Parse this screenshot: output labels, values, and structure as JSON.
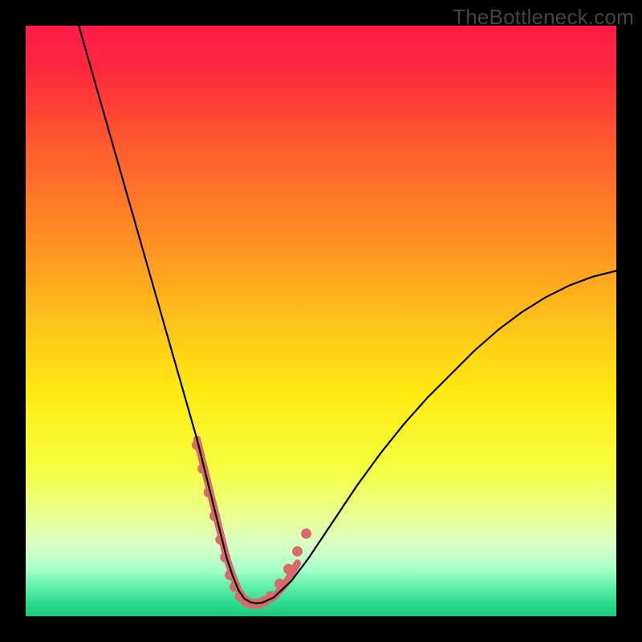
{
  "watermark": "TheBottleneck.com",
  "chart_data": {
    "type": "line",
    "title": "",
    "xlabel": "",
    "ylabel": "",
    "xlim": [
      0,
      100
    ],
    "ylim": [
      0,
      100
    ],
    "background_gradient": {
      "stops": [
        {
          "offset": 0.0,
          "color": "#ff1a4a"
        },
        {
          "offset": 0.08,
          "color": "#ff2a3e"
        },
        {
          "offset": 0.2,
          "color": "#ff5a2e"
        },
        {
          "offset": 0.35,
          "color": "#ff8a24"
        },
        {
          "offset": 0.5,
          "color": "#ffc21a"
        },
        {
          "offset": 0.62,
          "color": "#ffea10"
        },
        {
          "offset": 0.75,
          "color": "#f5ff40"
        },
        {
          "offset": 0.83,
          "color": "#eaff90"
        },
        {
          "offset": 0.88,
          "color": "#d8ffc8"
        },
        {
          "offset": 0.92,
          "color": "#a8ffc8"
        },
        {
          "offset": 0.95,
          "color": "#60f0a8"
        },
        {
          "offset": 0.975,
          "color": "#30dd90"
        },
        {
          "offset": 1.0,
          "color": "#18c878"
        }
      ]
    },
    "series": [
      {
        "name": "bottleneck-curve",
        "color": "#000000",
        "stroke_width": 2.2,
        "x": [
          9,
          11,
          13,
          15,
          17,
          19,
          21,
          23,
          25,
          27,
          29,
          30,
          31,
          32,
          33,
          34,
          35,
          36,
          37,
          38,
          39,
          40,
          42,
          45,
          48,
          52,
          56,
          60,
          64,
          68,
          72,
          76,
          80,
          84,
          88,
          92,
          96,
          100
        ],
        "y": [
          100,
          93,
          86,
          79,
          72,
          65,
          58,
          51,
          44,
          37,
          30,
          26,
          22,
          18,
          14,
          10,
          7,
          4.5,
          3,
          2.4,
          2.2,
          2.3,
          3.2,
          6,
          10,
          16,
          22,
          27.5,
          32.5,
          37,
          41,
          45,
          48.5,
          51.5,
          54,
          56,
          57.5,
          58.5
        ]
      }
    ],
    "highlight_segments": [
      {
        "name": "left-highlight",
        "color": "#d86a6a",
        "stroke_width": 9,
        "x": [
          29,
          30,
          31,
          32,
          33,
          34,
          35,
          36,
          37,
          38,
          39,
          40
        ],
        "y": [
          30,
          26,
          22,
          18,
          14,
          10,
          7,
          4.5,
          3,
          2.4,
          2.2,
          2.3
        ]
      },
      {
        "name": "right-highlight",
        "color": "#d86a6a",
        "stroke_width": 9,
        "x": [
          40,
          42,
          44,
          46
        ],
        "y": [
          2.3,
          3.2,
          5.5,
          9
        ]
      }
    ],
    "highlight_dots": {
      "color": "#d86a6a",
      "radius": 6.5,
      "points": [
        {
          "x": 29.0,
          "y": 29
        },
        {
          "x": 30.0,
          "y": 25
        },
        {
          "x": 31.0,
          "y": 21
        },
        {
          "x": 32.0,
          "y": 17
        },
        {
          "x": 33.0,
          "y": 13
        },
        {
          "x": 33.8,
          "y": 10
        },
        {
          "x": 34.6,
          "y": 7
        },
        {
          "x": 35.4,
          "y": 5
        },
        {
          "x": 36.3,
          "y": 3.4
        },
        {
          "x": 37.2,
          "y": 2.6
        },
        {
          "x": 38.0,
          "y": 2.2
        },
        {
          "x": 38.8,
          "y": 2.1
        },
        {
          "x": 39.6,
          "y": 2.2
        },
        {
          "x": 40.5,
          "y": 2.6
        },
        {
          "x": 41.5,
          "y": 3.4
        },
        {
          "x": 43.0,
          "y": 5.5
        },
        {
          "x": 44.5,
          "y": 8
        },
        {
          "x": 46.0,
          "y": 11
        },
        {
          "x": 47.5,
          "y": 14
        }
      ]
    }
  }
}
